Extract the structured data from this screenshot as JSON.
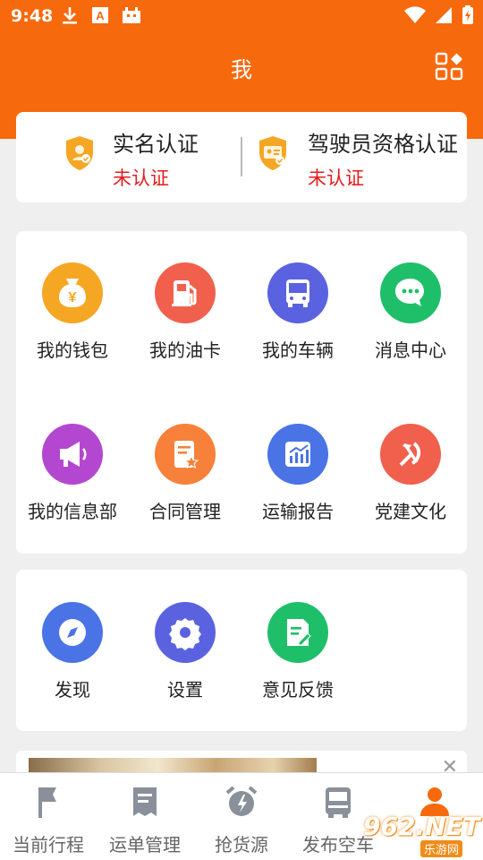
{
  "status_bar": {
    "time": "9:48"
  },
  "header": {
    "title": "我"
  },
  "auth": {
    "items": [
      {
        "title": "实名认证",
        "status": "未认证"
      },
      {
        "title": "驾驶员资格认证",
        "status": "未认证"
      }
    ]
  },
  "menu": {
    "items": [
      {
        "label": "我的钱包",
        "color": "#f5a623"
      },
      {
        "label": "我的油卡",
        "color": "#f0604d"
      },
      {
        "label": "我的车辆",
        "color": "#5b62e0"
      },
      {
        "label": "消息中心",
        "color": "#1fbf6a"
      },
      {
        "label": "我的信息部",
        "color": "#b447d0"
      },
      {
        "label": "合同管理",
        "color": "#f7813a"
      },
      {
        "label": "运输报告",
        "color": "#4a73e6"
      },
      {
        "label": "党建文化",
        "color": "#f0604d"
      }
    ]
  },
  "tools": {
    "items": [
      {
        "label": "发现",
        "color": "#4a73e6"
      },
      {
        "label": "设置",
        "color": "#5b62e0"
      },
      {
        "label": "意见反馈",
        "color": "#1fbf6a"
      }
    ]
  },
  "tabbar": {
    "tabs": [
      {
        "label": "当前行程"
      },
      {
        "label": "运单管理"
      },
      {
        "label": "抢货源"
      },
      {
        "label": "发布空车"
      },
      {
        "label": "我"
      }
    ],
    "active_color": "#f7690d",
    "inactive_color": "#8a9099"
  },
  "watermark": {
    "main": "962.NET",
    "sub": "乐游网"
  }
}
